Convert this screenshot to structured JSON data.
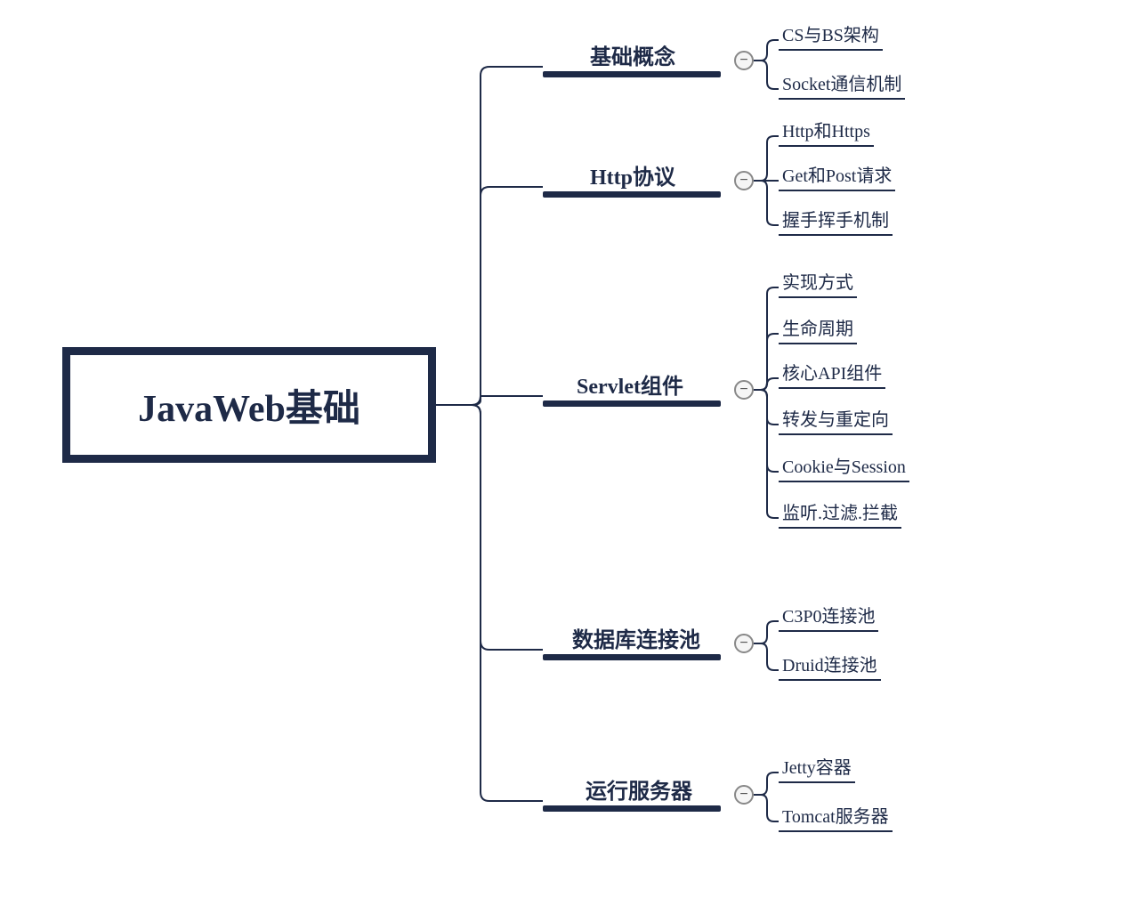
{
  "root": {
    "title": "JavaWeb基础"
  },
  "branches": [
    {
      "label": "基础概念",
      "leaves": [
        "CS与BS架构",
        "Socket通信机制"
      ]
    },
    {
      "label": "Http协议",
      "leaves": [
        "Http和Https",
        "Get和Post请求",
        "握手挥手机制"
      ]
    },
    {
      "label": "Servlet组件",
      "leaves": [
        "实现方式",
        "生命周期",
        "核心API组件",
        "转发与重定向",
        "Cookie与Session",
        "监听.过滤.拦截"
      ]
    },
    {
      "label": "数据库连接池",
      "leaves": [
        "C3P0连接池",
        "Druid连接池"
      ]
    },
    {
      "label": "运行服务器",
      "leaves": [
        "Jetty容器",
        "Tomcat服务器"
      ]
    }
  ],
  "collapse_icon": "−"
}
